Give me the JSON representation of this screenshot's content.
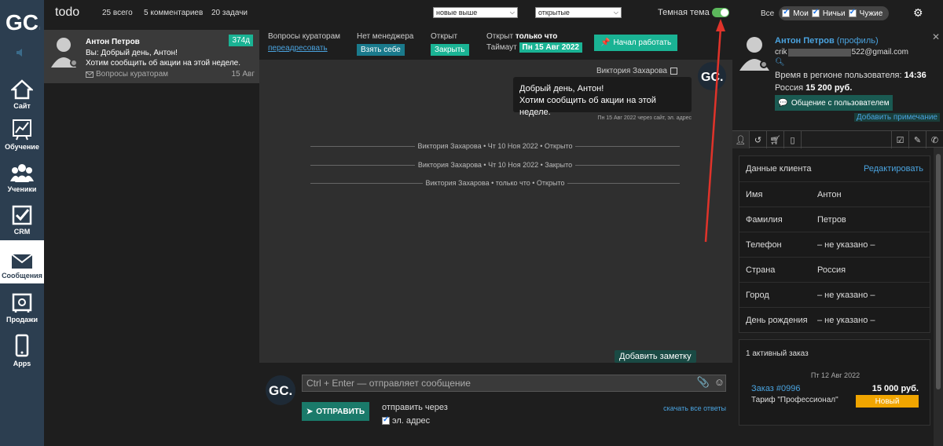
{
  "brand": {
    "logo_text": "GC."
  },
  "nav": [
    {
      "icon": "home-icon",
      "label": "Сайт"
    },
    {
      "icon": "chart-icon",
      "label": "Обучение"
    },
    {
      "icon": "users-icon",
      "label": "Ученики"
    },
    {
      "icon": "checkbox-icon",
      "label": "CRM"
    },
    {
      "icon": "envelope-icon",
      "label": "Сообщения",
      "active": true
    },
    {
      "icon": "safe-icon",
      "label": "Продажи"
    },
    {
      "icon": "phone-icon",
      "label": "Apps"
    }
  ],
  "topbar": {
    "title": "todo",
    "total": "25 всего",
    "comments": "5 комментариев",
    "tasks": "20 задачи",
    "sort_select": "новые выше",
    "status_select": "открытые",
    "theme_label": "Темная тема",
    "theme_on": true,
    "filter_all": "Все",
    "filter_mine": "Мои",
    "filter_nobody": "Ничьи",
    "filter_others": "Чужие"
  },
  "conversation": {
    "name": "Антон Петров",
    "line1": "Вы: Добрый день, Антон!",
    "line2": "Хотим сообщить об акции на этой неделе.",
    "source": "Вопросы кураторам",
    "date": "15 Авг",
    "badge": "374д"
  },
  "chat_header": {
    "topic_label": "Вопросы кураторам",
    "redirect_link": "переадресовать",
    "manager_label": "Нет менеджера",
    "take_button": "Взять себе",
    "open_label": "Открыт",
    "close_button": "Закрыть",
    "open_since_prefix": "Открыт",
    "open_since_value": "только что",
    "timeout_label": "Таймаут",
    "timeout_value": "Пн 15 Авг 2022",
    "start_button": "Начал работать"
  },
  "messages": {
    "author": "Виктория Захарова",
    "bubble_line1": "Добрый день, Антон!",
    "bubble_line2": "Хотим сообщить об акции на этой неделе.",
    "meta": "Пн 15 Авг 2022 через сайт, эл. адрес",
    "system": [
      "Виктория Захарова • Чт 10 Ноя 2022 • Открыто",
      "Виктория Захарова • Чт 10 Ноя 2022 • Закрыто",
      "Виктория Захарова • только что • Открыто"
    ],
    "add_note": "Добавить заметку"
  },
  "composer": {
    "placeholder": "Ctrl + Enter — отправляет сообщение",
    "send_button": "ОТПРАВИТЬ",
    "send_via": "отправить через",
    "email_option": "эл. адрес",
    "download_all": "скачать все ответы"
  },
  "profile": {
    "name": "Антон Петров",
    "profile_link": "(профиль)",
    "email_prefix": "crik",
    "email_suffix": "522@gmail.com",
    "time_label": "Время в регионе пользователя:",
    "time_value": "14:36",
    "country_prefix": "Россия",
    "ltv": "15 200 руб.",
    "chat_button": "Общение с пользователем",
    "add_note": "Добавить примечание"
  },
  "client_data": {
    "title": "Данные клиента",
    "edit": "Редактировать",
    "rows": [
      {
        "k": "Имя",
        "v": "Антон"
      },
      {
        "k": "Фамилия",
        "v": "Петров"
      },
      {
        "k": "Телефон",
        "v": "– не указано –"
      },
      {
        "k": "Страна",
        "v": "Россия"
      },
      {
        "k": "Город",
        "v": "– не указано –"
      },
      {
        "k": "День рождения",
        "v": "– не указано –"
      }
    ]
  },
  "order": {
    "header": "1 активный заказ",
    "date": "Пт 12 Авг 2022",
    "number": "Заказ #0996",
    "price": "15 000 руб.",
    "tariff": "Тариф \"Профессионал\"",
    "status": "Новый"
  },
  "colors": {
    "accent": "#1ab394",
    "link": "#4aa3df",
    "nav": "#2c3e50",
    "order_status": "#f0a500"
  }
}
